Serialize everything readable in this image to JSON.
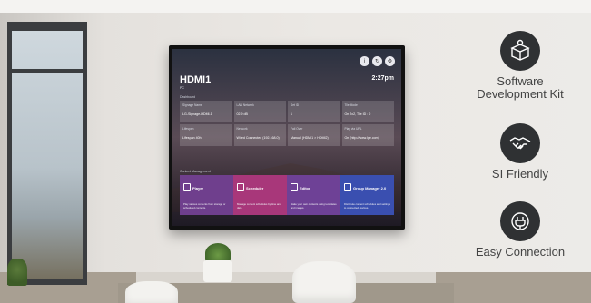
{
  "tv": {
    "title": "HDMI1",
    "subtitle": "PC",
    "time": "2:27pm",
    "dashboard_label": "Dashboard",
    "content_label": "Content Management",
    "tiles": [
      {
        "label": "Signage Name",
        "value": "LG-Signage-HDMI-1"
      },
      {
        "label": "LAN Network",
        "value": "02.9 dB"
      },
      {
        "label": "Set ID",
        "value": "1"
      },
      {
        "label": "Tile Mode",
        "value": "On 2x2, Tile ID : 0"
      },
      {
        "label": "Lifespan",
        "value": "Lifespan 40h"
      },
      {
        "label": "Network",
        "value": "Wired Connected (192.168.0)"
      },
      {
        "label": "Fail Over",
        "value": "Manual (HDMI1 > HDMI2)"
      },
      {
        "label": "Play via URL",
        "value": "On (http://www.lge.com)"
      }
    ],
    "apps": [
      {
        "name": "Player",
        "desc": "Play various contents from storage or scheduled contents.",
        "color": "#6f3f8d"
      },
      {
        "name": "Scheduler",
        "desc": "Manage content schedules by time and date.",
        "color": "#a8377a"
      },
      {
        "name": "Editor",
        "desc": "Make your own contents using templates and images.",
        "color": "#6e4196"
      },
      {
        "name": "Group Manager 2.0",
        "desc": "Distribute content schedules and settings to connected devices.",
        "color": "#3a4fb0"
      }
    ]
  },
  "features": [
    {
      "label": "Software Development Kit",
      "icon": "software-box-icon"
    },
    {
      "label": "SI Friendly",
      "icon": "handshake-icon"
    },
    {
      "label": "Easy Connection",
      "icon": "power-plug-icon"
    }
  ]
}
